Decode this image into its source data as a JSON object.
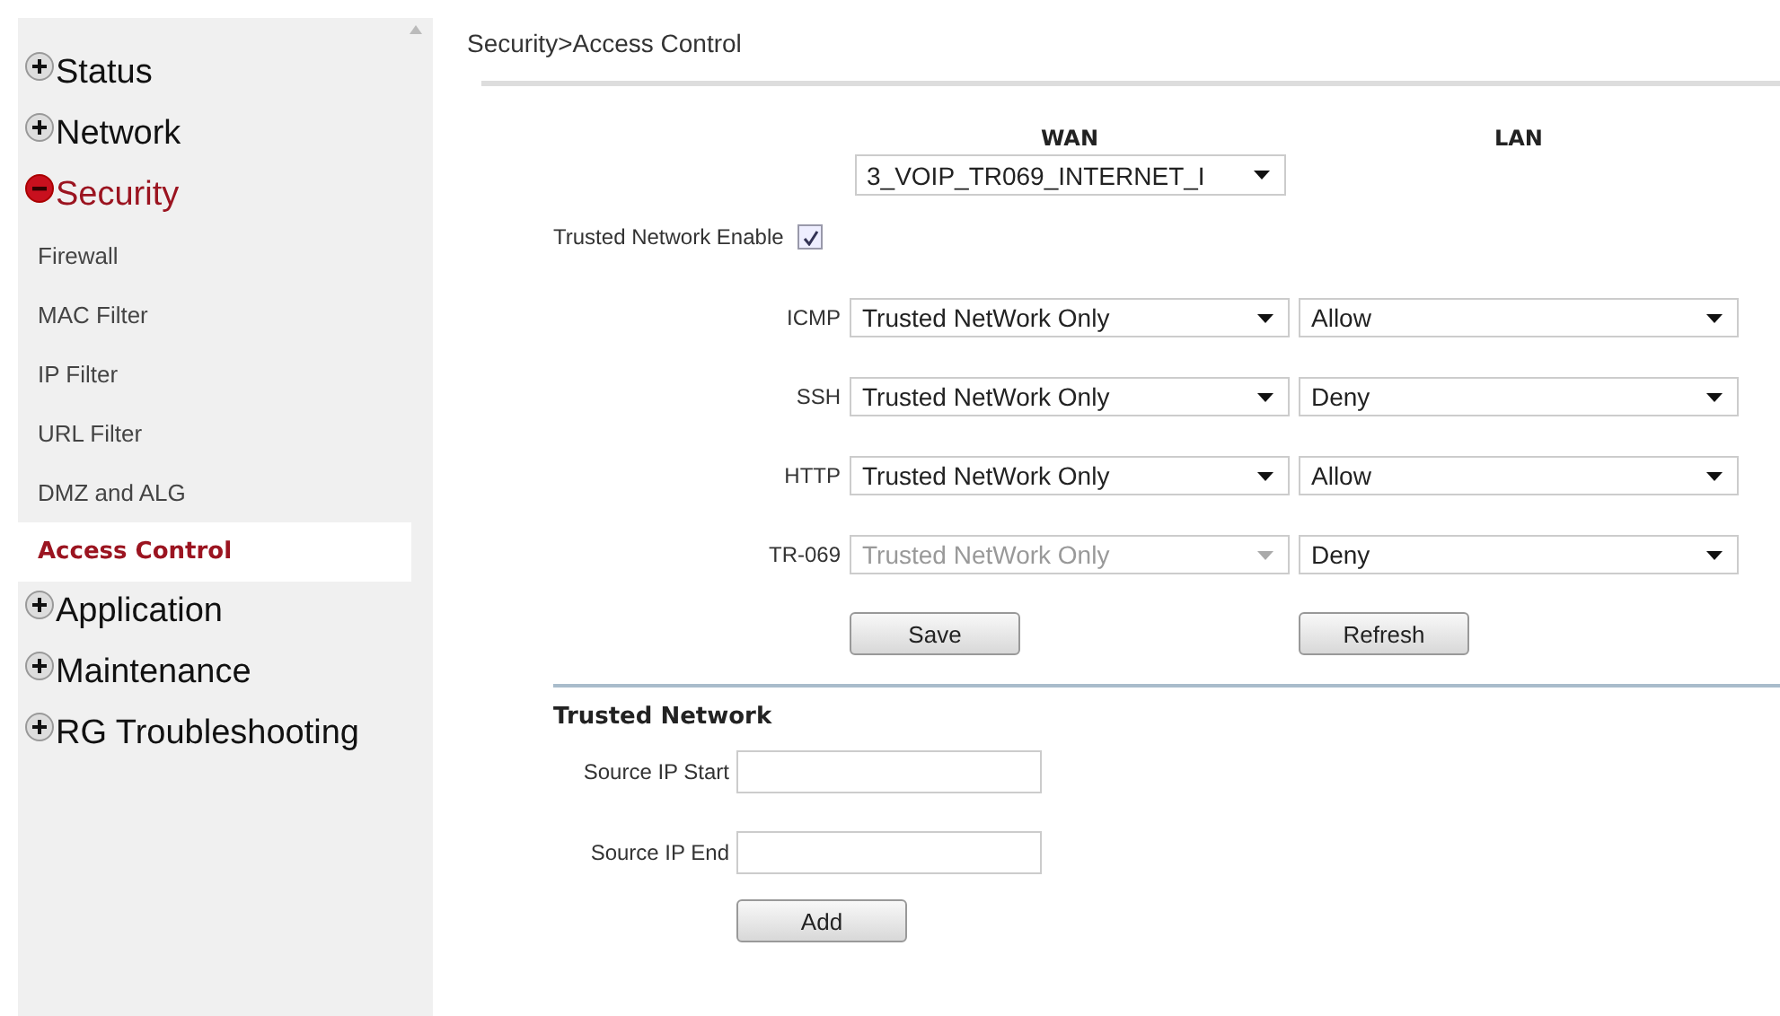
{
  "breadcrumb": "Security>Access Control",
  "sidebar": {
    "items": [
      {
        "label": "Status",
        "expanded": false
      },
      {
        "label": "Network",
        "expanded": false
      },
      {
        "label": "Security",
        "expanded": true,
        "children": [
          {
            "label": "Firewall",
            "selected": false
          },
          {
            "label": "MAC Filter",
            "selected": false
          },
          {
            "label": "IP Filter",
            "selected": false
          },
          {
            "label": "URL Filter",
            "selected": false
          },
          {
            "label": "DMZ and ALG",
            "selected": false
          },
          {
            "label": "Access Control",
            "selected": true
          }
        ]
      },
      {
        "label": "Application",
        "expanded": false
      },
      {
        "label": "Maintenance",
        "expanded": false
      },
      {
        "label": "RG Troubleshooting",
        "expanded": false
      }
    ]
  },
  "access_control": {
    "columns": [
      "WAN",
      "LAN"
    ],
    "wan_interface": {
      "value": "3_VOIP_TR069_INTERNET_I"
    },
    "trusted_network_enable": {
      "label": "Trusted Network Enable",
      "checked": true
    },
    "rules": [
      {
        "protocol": "ICMP",
        "wan": {
          "value": "Trusted NetWork Only",
          "disabled": false
        },
        "lan": {
          "value": "Allow",
          "disabled": false
        }
      },
      {
        "protocol": "SSH",
        "wan": {
          "value": "Trusted NetWork Only",
          "disabled": false
        },
        "lan": {
          "value": "Deny",
          "disabled": false
        }
      },
      {
        "protocol": "HTTP",
        "wan": {
          "value": "Trusted NetWork Only",
          "disabled": false
        },
        "lan": {
          "value": "Allow",
          "disabled": false
        }
      },
      {
        "protocol": "TR-069",
        "wan": {
          "value": "Trusted NetWork Only",
          "disabled": true
        },
        "lan": {
          "value": "Deny",
          "disabled": false
        }
      }
    ],
    "buttons": [
      "Save",
      "Refresh"
    ]
  },
  "trusted_network": {
    "title": "Trusted Network",
    "fields": [
      {
        "label": "Source IP Start"
      },
      {
        "label": "Source IP End"
      }
    ],
    "button": "Add"
  }
}
